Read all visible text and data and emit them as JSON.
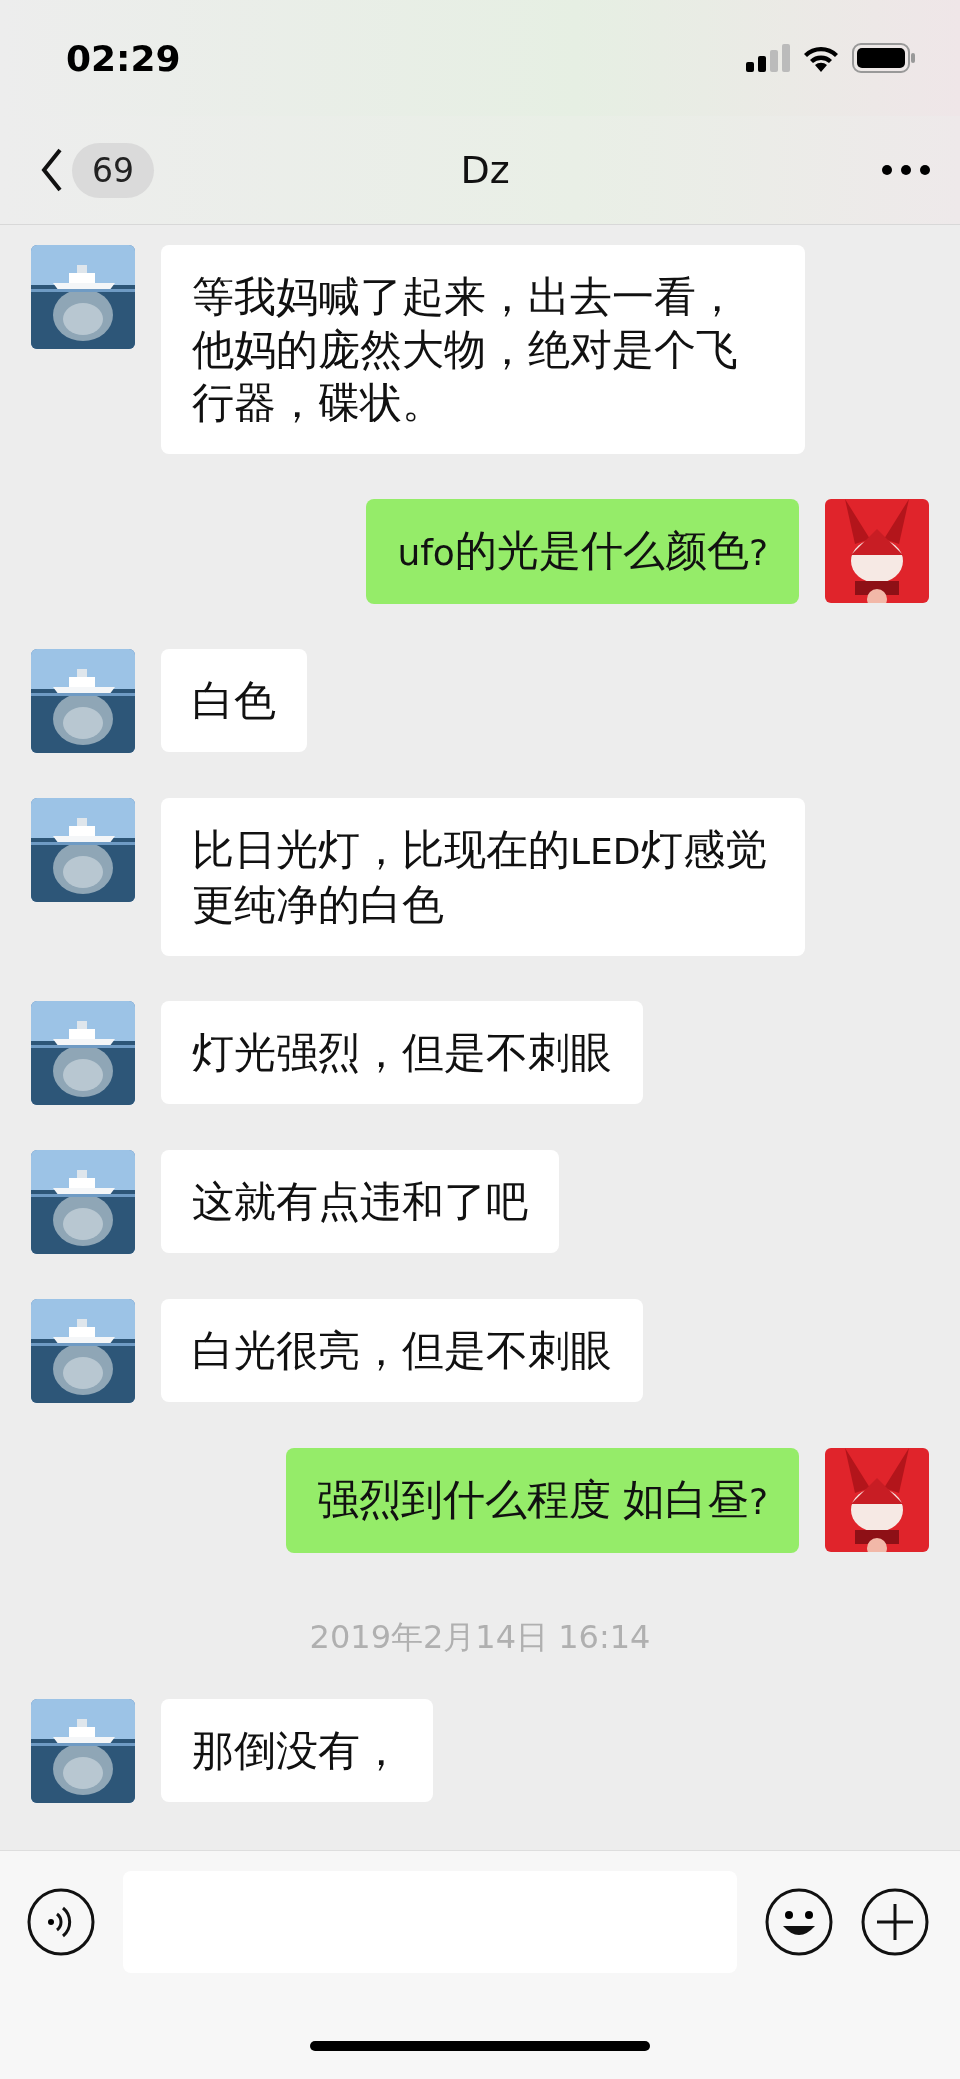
{
  "status_bar": {
    "time": "02:29"
  },
  "nav": {
    "unread": "69",
    "title": "Dz"
  },
  "messages": [
    {
      "kind": "other",
      "text": "等我妈喊了起来，出去一看，他妈的庞然大物，绝对是个飞行器，碟状。"
    },
    {
      "kind": "self",
      "text": "ufo的光是什么颜色?"
    },
    {
      "kind": "other",
      "text": "白色"
    },
    {
      "kind": "other",
      "text": "比日光灯，比现在的LED灯感觉更纯净的白色"
    },
    {
      "kind": "other",
      "text": "灯光强烈，但是不刺眼"
    },
    {
      "kind": "other",
      "text": "这就有点违和了吧"
    },
    {
      "kind": "other",
      "text": "白光很亮，但是不刺眼"
    },
    {
      "kind": "self",
      "text": "强烈到什么程度 如白昼?"
    },
    {
      "kind": "time",
      "text": "2019年2月14日 16:14"
    },
    {
      "kind": "other",
      "text": "那倒没有，"
    }
  ]
}
